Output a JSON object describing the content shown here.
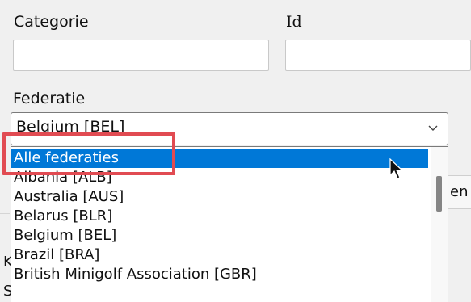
{
  "form": {
    "categorie_label": "Categorie",
    "categorie_value": "",
    "id_label": "Id",
    "id_value": "",
    "federatie_label": "Federatie",
    "federatie_selected": "Belgium [BEL]"
  },
  "dropdown": {
    "options": [
      "Alle federaties",
      "Albania [ALB]",
      "Australia [AUS]",
      "Belarus [BLR]",
      "Belgium [BEL]",
      "Brazil [BRA]",
      "British Minigolf Association [GBR]",
      ""
    ],
    "highlighted_index": 0
  },
  "background": {
    "partial_button_text": "en",
    "partial_left_text_1": "K",
    "partial_left_text_2": "S"
  },
  "colors": {
    "selection": "#0078d7",
    "highlight_box": "#e14b52"
  },
  "icons": {
    "combo_arrow": "chevron-down-icon",
    "pointer": "mouse-pointer-icon"
  }
}
